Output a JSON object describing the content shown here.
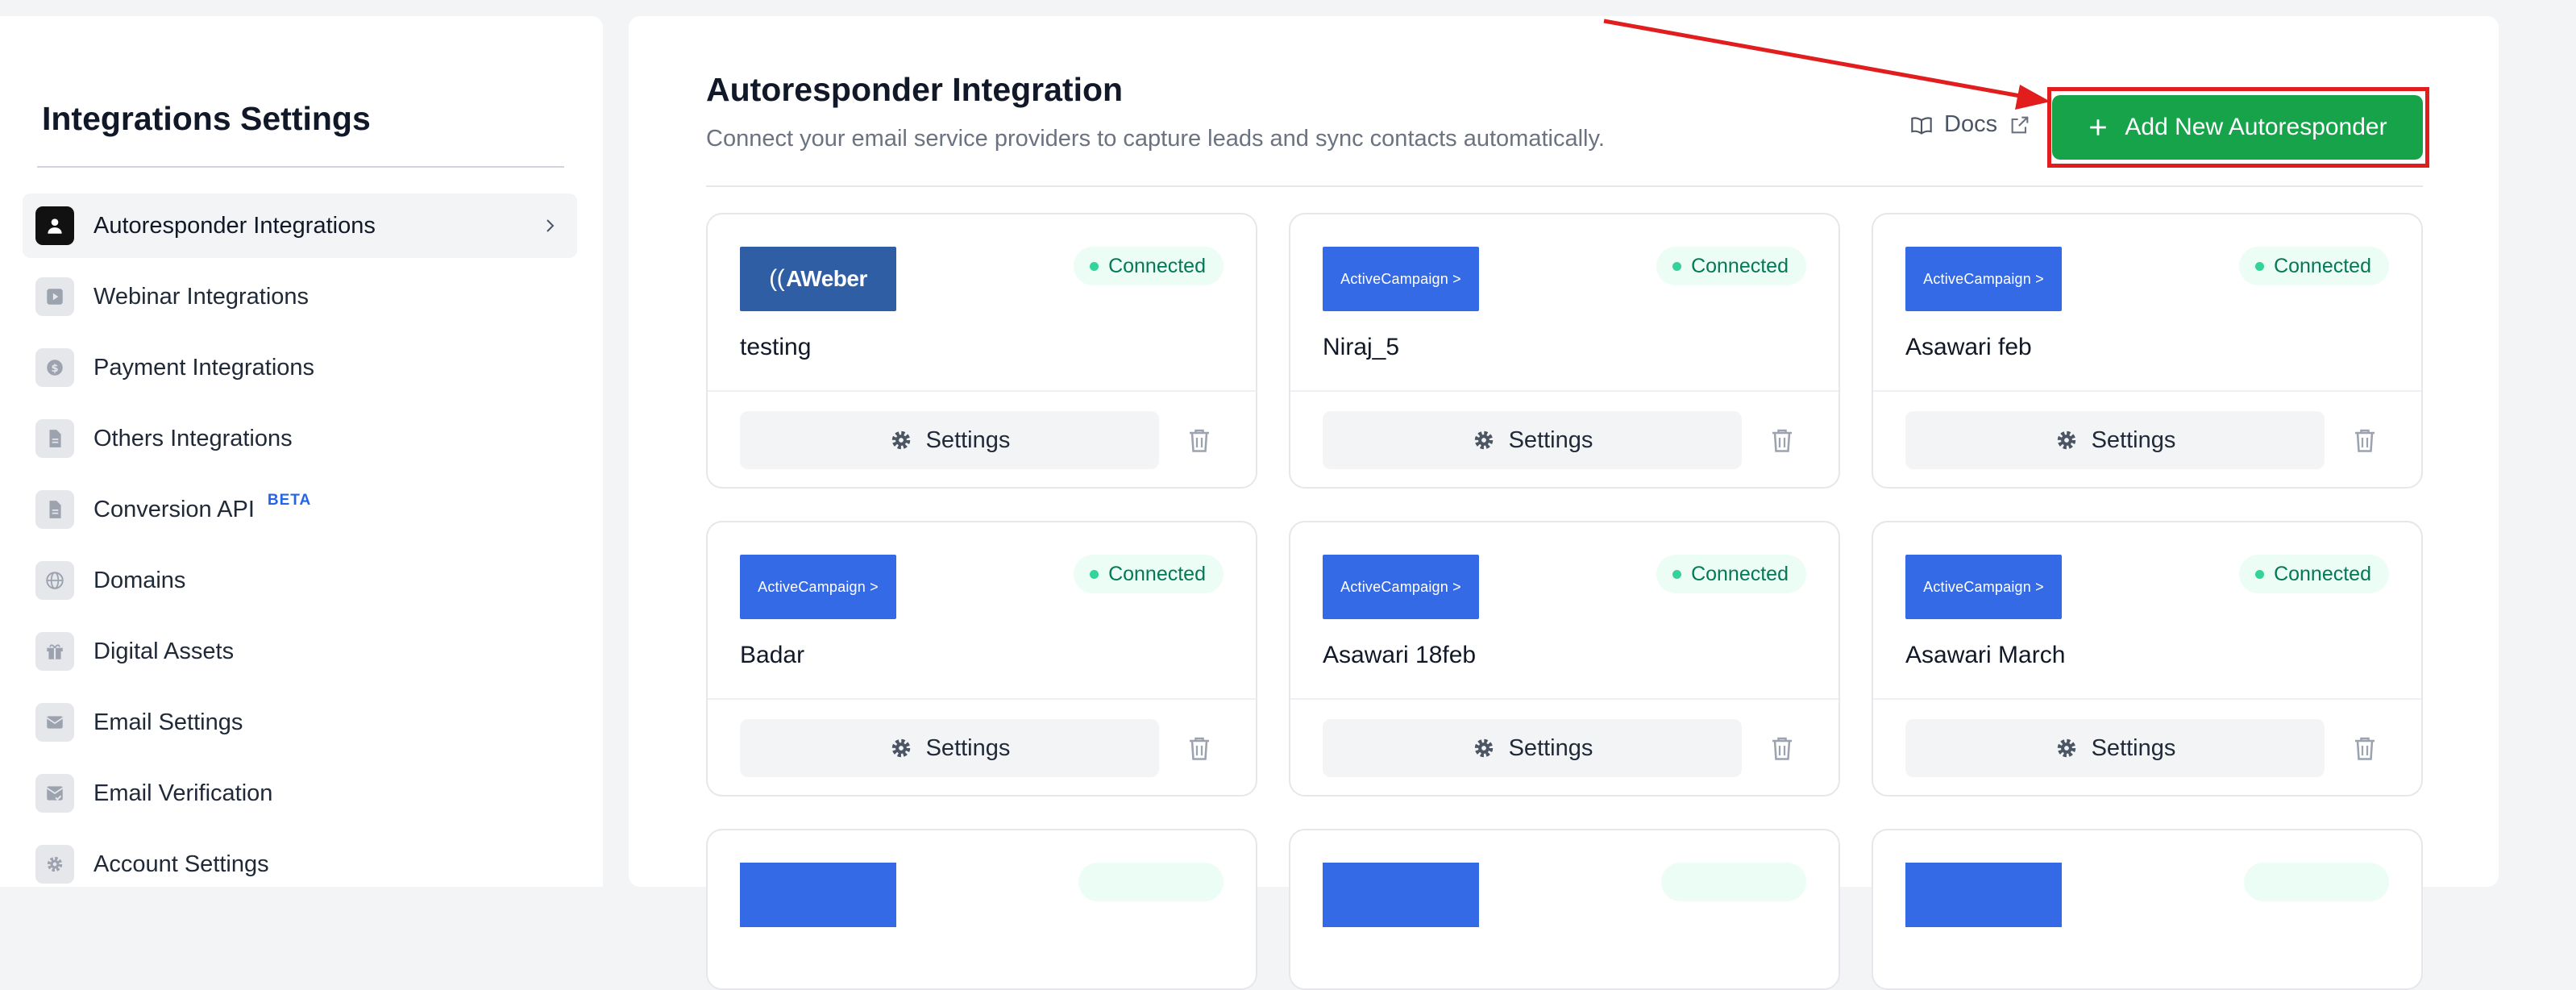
{
  "sidebar": {
    "title": "Integrations Settings",
    "items": [
      {
        "label": "Autoresponder Integrations",
        "icon": "user-icon",
        "active": true
      },
      {
        "label": "Webinar Integrations",
        "icon": "play-icon"
      },
      {
        "label": "Payment Integrations",
        "icon": "dollar-icon"
      },
      {
        "label": "Others Integrations",
        "icon": "document-icon"
      },
      {
        "label": "Conversion API",
        "icon": "document-icon",
        "badge": "BETA"
      },
      {
        "label": "Domains",
        "icon": "globe-icon"
      },
      {
        "label": "Digital Assets",
        "icon": "gift-icon"
      },
      {
        "label": "Email Settings",
        "icon": "mail-icon"
      },
      {
        "label": "Email Verification",
        "icon": "mail-check-icon"
      },
      {
        "label": "Account Settings",
        "icon": "gear-icon"
      }
    ]
  },
  "main": {
    "title": "Autoresponder Integration",
    "subtitle": "Connect your email service providers to capture leads and sync contacts automatically.",
    "docs_label": "Docs",
    "add_button_label": "Add New Autoresponder"
  },
  "cards": [
    {
      "provider": "AWeber",
      "logo_text": "AWeber",
      "status": "Connected",
      "name": "testing",
      "settings_label": "Settings"
    },
    {
      "provider": "ActiveCampaign",
      "logo_text": "ActiveCampaign >",
      "status": "Connected",
      "name": "Niraj_5",
      "settings_label": "Settings"
    },
    {
      "provider": "ActiveCampaign",
      "logo_text": "ActiveCampaign >",
      "status": "Connected",
      "name": "Asawari feb",
      "settings_label": "Settings"
    },
    {
      "provider": "ActiveCampaign",
      "logo_text": "ActiveCampaign >",
      "status": "Connected",
      "name": "Badar",
      "settings_label": "Settings"
    },
    {
      "provider": "ActiveCampaign",
      "logo_text": "ActiveCampaign >",
      "status": "Connected",
      "name": "Asawari 18feb",
      "settings_label": "Settings"
    },
    {
      "provider": "ActiveCampaign",
      "logo_text": "ActiveCampaign >",
      "status": "Connected",
      "name": "Asawari March",
      "settings_label": "Settings"
    }
  ],
  "colors": {
    "accent_green": "#16a34a",
    "annotation_red": "#e11d1d",
    "status_green": "#047857",
    "aweber_blue": "#2f5ea5",
    "activecampaign_blue": "#356ae6",
    "beta_blue": "#2563eb"
  }
}
